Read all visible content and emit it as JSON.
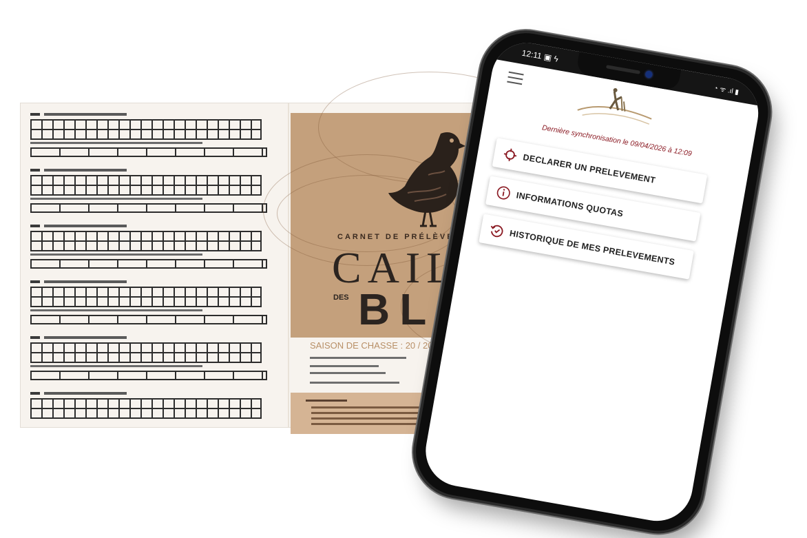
{
  "booklet": {
    "cover_kicker": "CARNET DE PRÉLÈVEMENT",
    "cover_title": "CAILL",
    "cover_des": "DES",
    "cover_subtitle": "BLÉ",
    "season_label": "SAISON DE CHASSE : 20     / 20",
    "cover_color": "#c4a07c"
  },
  "phone": {
    "status": {
      "time": "12:11",
      "icons": "▣ ϟ",
      "right_icons": "◔ ᯤ .ıl ▮"
    },
    "menu_icon": "hamburger-icon",
    "logo_icon": "hunter-logo-icon",
    "sync_text": "Dernière synchronisation le 09/04/2026 à 12:09",
    "accent_color": "#8b1b24",
    "buttons": [
      {
        "label": "DECLARER UN PRELEVEMENT",
        "icon": "target-icon"
      },
      {
        "label": "INFORMATIONS QUOTAS",
        "icon": "info-icon"
      },
      {
        "label": "HISTORIQUE DE MES PRELEVEMENTS",
        "icon": "history-icon"
      }
    ]
  }
}
